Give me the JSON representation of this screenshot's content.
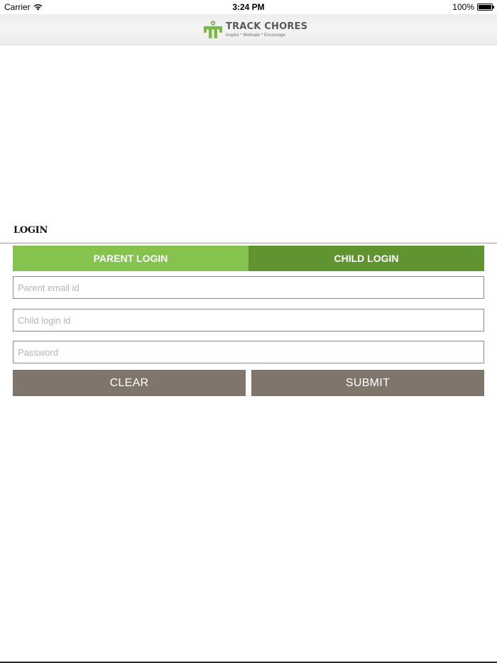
{
  "status_bar": {
    "carrier": "Carrier",
    "time": "3:24 PM",
    "battery": "100%",
    "wifi_icon": "wifi-icon",
    "battery_icon": "battery-icon",
    "battery_level": 1.0
  },
  "header": {
    "logo_title": "TRACK CHORES",
    "logo_tagline": "Inspire * Motivate * Encourage",
    "logo_icon": "track-chores-logo-icon",
    "colors": {
      "logo_green": "#7ab648",
      "logo_text": "#5b5a58"
    }
  },
  "login": {
    "title": "LOGIN",
    "tabs": [
      {
        "label": "PARENT LOGIN",
        "color": "#84c34e"
      },
      {
        "label": "CHILD LOGIN",
        "color": "#5f9430"
      }
    ],
    "fields": {
      "parent_email": {
        "placeholder": "Parent email id",
        "value": ""
      },
      "child_login": {
        "placeholder": "Child login id",
        "value": ""
      },
      "password": {
        "placeholder": "Password",
        "value": ""
      }
    },
    "buttons": {
      "clear": "CLEAR",
      "submit": "SUBMIT",
      "color": "#80756a"
    }
  }
}
